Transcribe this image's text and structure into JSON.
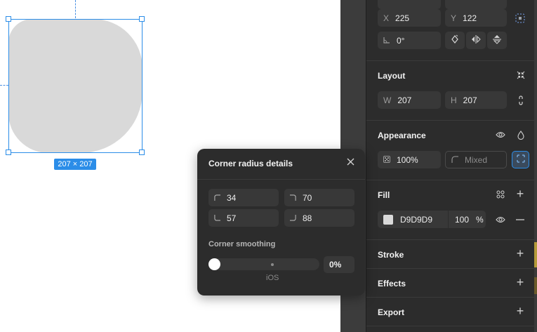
{
  "canvas": {
    "size_label": "207 × 207",
    "shape_fill": "#D9D9D9",
    "selection_color": "#2B8DE8"
  },
  "position": {
    "x_label": "X",
    "x_value": "225",
    "y_label": "Y",
    "y_value": "122",
    "rotation_value": "0°"
  },
  "layout": {
    "title": "Layout",
    "w_label": "W",
    "w_value": "207",
    "h_label": "H",
    "h_value": "207"
  },
  "appearance": {
    "title": "Appearance",
    "opacity": "100%",
    "radius_placeholder": "Mixed"
  },
  "fill": {
    "title": "Fill",
    "hex": "D9D9D9",
    "swatch_color": "#D9D9D9",
    "opacity": "100",
    "percent_symbol": "%"
  },
  "stroke": {
    "title": "Stroke"
  },
  "effects": {
    "title": "Effects"
  },
  "export": {
    "title": "Export"
  },
  "corner_popover": {
    "title": "Corner radius details",
    "top_left": "34",
    "top_right": "70",
    "bottom_left": "57",
    "bottom_right": "88",
    "smoothing_label": "Corner smoothing",
    "smoothing_value": "0%",
    "smoothing_fraction": 0,
    "ios_label": "iOS"
  },
  "icons": {
    "close": "close-icon",
    "eye": "eye-icon",
    "drop": "drop-icon",
    "plus": "plus-icon",
    "minus": "minus-icon",
    "grid": "grid-icon"
  }
}
